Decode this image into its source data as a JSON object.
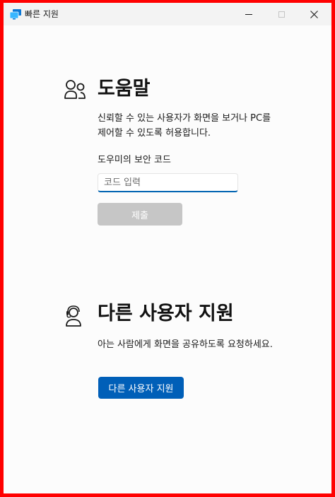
{
  "window": {
    "title": "빠른 지원",
    "controls": {
      "minimize_icon": "minimize-icon",
      "maximize_icon": "maximize-icon",
      "close_icon": "close-icon",
      "close_glyph": "✕"
    }
  },
  "help_section": {
    "icon": "people-icon",
    "heading": "도움말",
    "description": "신뢰할 수 있는 사용자가 화면을 보거나 PC를 제어할 수 있도록 허용합니다.",
    "code_label": "도우미의 보안 코드",
    "code_input": {
      "value": "",
      "placeholder": "코드 입력"
    },
    "submit_label": "제출"
  },
  "helper_section": {
    "icon": "headset-person-icon",
    "heading": "다른 사용자 지원",
    "description": "아는 사람에게 화면을 공유하도록 요청하세요.",
    "button_label": "다른 사용자 지원"
  },
  "colors": {
    "accent": "#005fb8",
    "frame": "#ff0000",
    "disabled_button": "#c6c6c6",
    "background": "#fcfcfc"
  }
}
